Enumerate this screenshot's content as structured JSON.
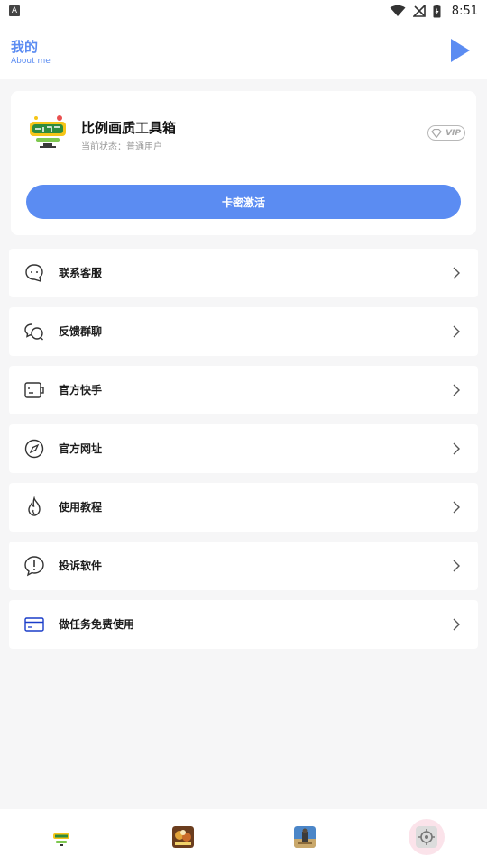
{
  "status_bar": {
    "time": "8:51",
    "app_indicator": "A",
    "icons": [
      "wifi-icon",
      "signal-off-icon",
      "battery-charging-icon"
    ]
  },
  "header": {
    "title": "我的",
    "subtitle": "About me",
    "action_icon": "play-icon",
    "accent_color": "#5b8cf2"
  },
  "profile": {
    "app_name": "比例画质工具箱",
    "status_label": "当前状态：",
    "status_value": "普通用户",
    "badge": "VIP",
    "activate_button": "卡密激活"
  },
  "menu": [
    {
      "icon": "chat-bubble-icon",
      "label": "联系客服"
    },
    {
      "icon": "group-chat-icon",
      "label": "反馈群聊"
    },
    {
      "icon": "video-card-icon",
      "label": "官方快手"
    },
    {
      "icon": "compass-icon",
      "label": "官方网址"
    },
    {
      "icon": "flame-icon",
      "label": "使用教程"
    },
    {
      "icon": "alert-icon",
      "label": "投诉软件"
    },
    {
      "icon": "credit-card-icon",
      "label": "做任务免费使用"
    }
  ],
  "bottom_nav": {
    "tabs": [
      {
        "icon": "home-thumb-icon"
      },
      {
        "icon": "game-thumb-icon"
      },
      {
        "icon": "pubg-thumb-icon"
      },
      {
        "icon": "settings-thumb-icon",
        "active": true
      }
    ],
    "active_color": "#fbe3ea"
  }
}
